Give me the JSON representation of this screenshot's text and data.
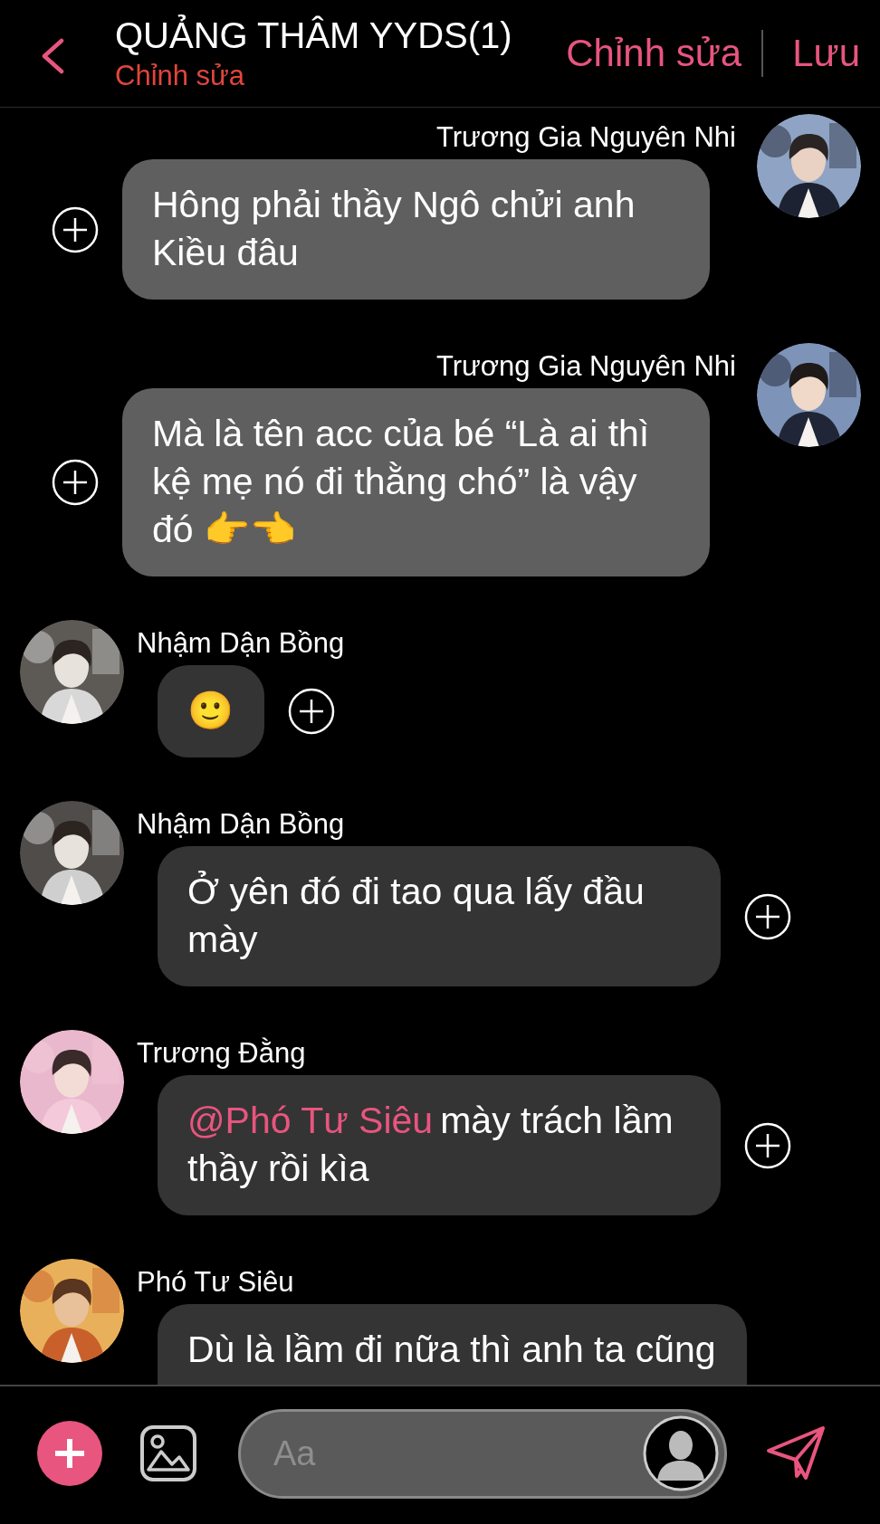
{
  "header": {
    "title": "QUẢNG THÂM YYDS(1)",
    "subtitle": "Chỉnh sửa",
    "actions": [
      "Chỉnh sửa",
      "Lưu"
    ]
  },
  "messages": [
    {
      "kind": "right",
      "sender": "Trương Gia Nguyên Nhi",
      "text": "Hông phải thầy Ngô chửi anh Kiều đâu"
    },
    {
      "kind": "right",
      "sender": "Trương Gia Nguyên Nhi",
      "text": "Mà là tên acc của bé “Là ai thì kệ mẹ nó đi thằng chó” là vậy đó 👉👈"
    },
    {
      "kind": "left",
      "sender": "Nhậm Dận Bồng",
      "text": "🙂"
    },
    {
      "kind": "left",
      "sender": "Nhậm Dận Bồng",
      "text": "Ở yên đó đi tao qua lấy đầu mày"
    },
    {
      "kind": "left",
      "sender": "Trương Đằng",
      "mention": "@Phó Tư Siêu",
      "text": "mày trách lầm thầy rồi kìa"
    },
    {
      "kind": "left",
      "sender": "Phó Tư Siêu",
      "text": "Dù là lầm đi nữa thì anh ta cũng"
    }
  ],
  "composer": {
    "placeholder": "Aa"
  }
}
